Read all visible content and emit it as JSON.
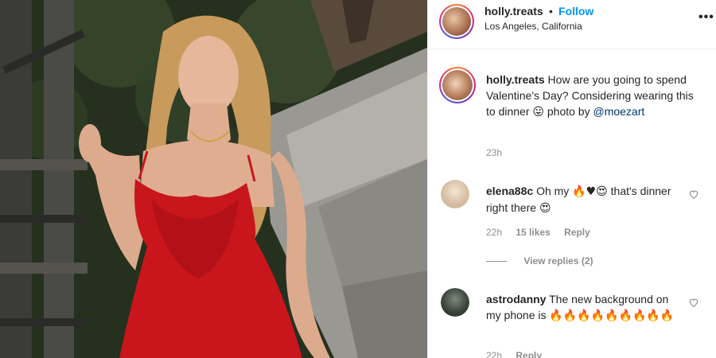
{
  "post": {
    "username": "holly.treats",
    "dot": "•",
    "follow_label": "Follow",
    "location": "Los Angeles, California",
    "more_label": "•••",
    "caption": {
      "username": "holly.treats",
      "text": "How are you going to spend Valentine's Day? Considering wearing this to dinner",
      "emoji": "😛",
      "photo_by": "photo by",
      "mention": "@moezart"
    },
    "time": "23h"
  },
  "comments": [
    {
      "username": "elena88c",
      "text_before": "Oh my",
      "emojis": "🔥♥😍",
      "text_after": "that's dinner right there",
      "emoji_end": "😍",
      "time": "22h",
      "likes": "15 likes",
      "reply_label": "Reply",
      "view_replies": "View replies (2)"
    },
    {
      "username": "astrodanny",
      "text": "The new background on my phone is",
      "emojis": "🔥🔥🔥🔥🔥🔥🔥🔥🔥",
      "time": "22h",
      "reply_label": "Reply"
    }
  ],
  "icons": {
    "heart": "heart-icon",
    "more": "more-options-icon"
  },
  "colors": {
    "follow": "#0095f6",
    "dress": "#c8161c",
    "meta": "#8e8e8e"
  }
}
